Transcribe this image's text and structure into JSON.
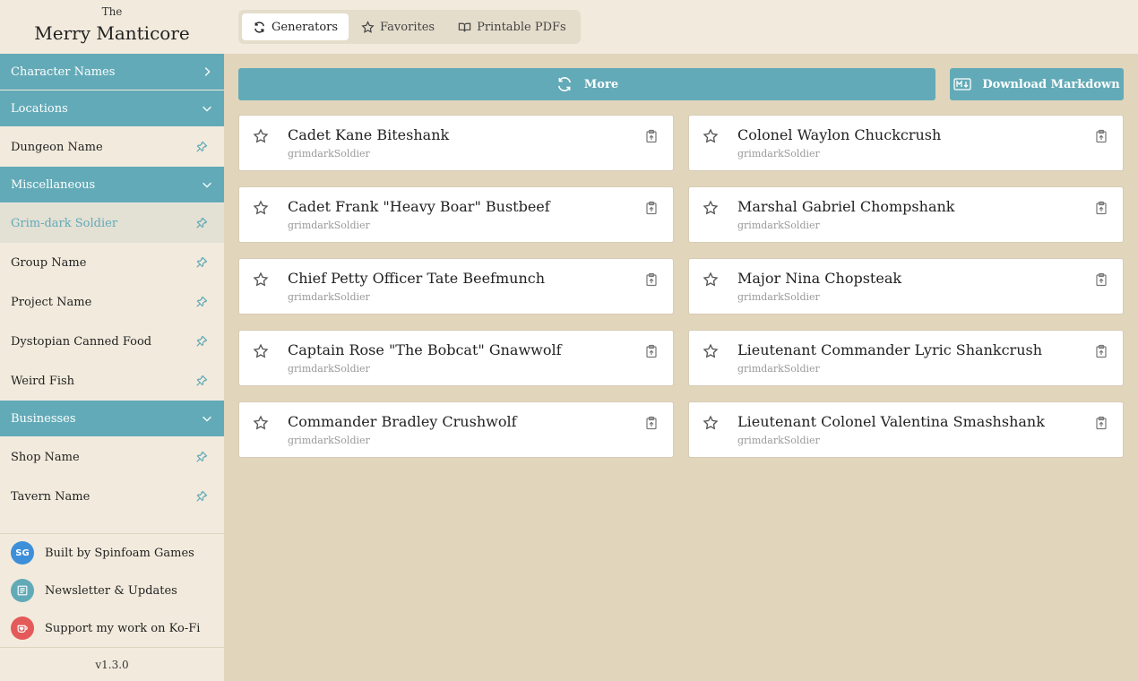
{
  "brand": {
    "small": "The",
    "big": "Merry Manticore"
  },
  "sections": [
    {
      "label": "Character Names",
      "items": []
    },
    {
      "label": "Locations",
      "items": [
        {
          "label": "Dungeon Name"
        }
      ]
    },
    {
      "label": "Miscellaneous",
      "items": [
        {
          "label": "Grim-dark Soldier"
        },
        {
          "label": "Group Name"
        },
        {
          "label": "Project Name"
        },
        {
          "label": "Dystopian Canned Food"
        },
        {
          "label": "Weird Fish"
        }
      ]
    },
    {
      "label": "Businesses",
      "items": [
        {
          "label": "Shop Name"
        },
        {
          "label": "Tavern Name"
        }
      ]
    }
  ],
  "footer": {
    "built_by": "Built by Spinfoam Games",
    "built_by_initials": "SG",
    "newsletter": "Newsletter & Updates",
    "kofi": "Support my work on Ko-Fi",
    "version": "v1.3.0"
  },
  "tabs": [
    {
      "label": "Generators"
    },
    {
      "label": "Favorites"
    },
    {
      "label": "Printable PDFs"
    }
  ],
  "actions": {
    "more": "More",
    "download": "Download Markdown"
  },
  "results": [
    {
      "name": "Cadet Kane Biteshank",
      "type": "grimdarkSoldier"
    },
    {
      "name": "Colonel Waylon Chuckcrush",
      "type": "grimdarkSoldier"
    },
    {
      "name": "Cadet Frank \"Heavy Boar\" Bustbeef",
      "type": "grimdarkSoldier"
    },
    {
      "name": "Marshal Gabriel Chompshank",
      "type": "grimdarkSoldier"
    },
    {
      "name": "Chief Petty Officer Tate Beefmunch",
      "type": "grimdarkSoldier"
    },
    {
      "name": "Major Nina Chopsteak",
      "type": "grimdarkSoldier"
    },
    {
      "name": "Captain Rose \"The Bobcat\" Gnawwolf",
      "type": "grimdarkSoldier"
    },
    {
      "name": "Lieutenant Commander Lyric Shankcrush",
      "type": "grimdarkSoldier"
    },
    {
      "name": "Commander Bradley Crushwolf",
      "type": "grimdarkSoldier"
    },
    {
      "name": "Lieutenant Colonel Valentina Smashshank",
      "type": "grimdarkSoldier"
    }
  ],
  "colors": {
    "accent": "#62aab7",
    "sidebar_bg": "#f2ebdd",
    "main_bg": "#e1d5bb",
    "kofi": "#e45a5a",
    "avatar": "#3d8fd9"
  }
}
